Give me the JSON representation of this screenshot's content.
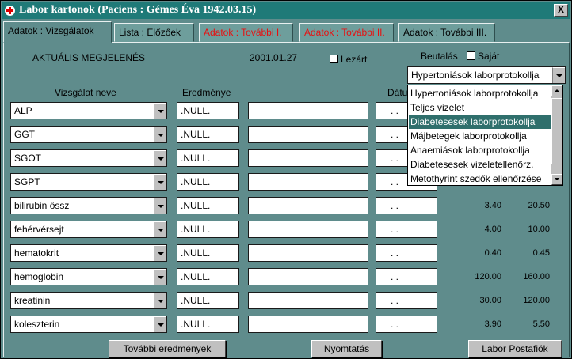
{
  "window": {
    "title": "Labor kartonok (Paciens : Gémes Éva 1942.03.15)",
    "close_label": "X"
  },
  "tabs": [
    {
      "label": "Adatok : Vizsgálatok",
      "active": true
    },
    {
      "label": "Lista : Előzőek"
    },
    {
      "label": "Adatok : További I."
    },
    {
      "label": "Adatok : További II."
    },
    {
      "label": "Adatok : További III."
    }
  ],
  "header": {
    "view_label": "AKTUÁLIS MEGJELENÉS",
    "date": "2001.01.27",
    "lezart_label": "Lezárt",
    "beutalas_label": "Beutalás",
    "sajat_label": "Saját",
    "protocol_selected": "Hypertoniások laborprotokollja"
  },
  "columns": {
    "name": "Vizsgálat neve",
    "result": "Eredménye",
    "date": "Dátum"
  },
  "rows": [
    {
      "name": "ALP",
      "result": ".NULL.",
      "note": "",
      "date": ". .",
      "min": "",
      "max": ""
    },
    {
      "name": "GGT",
      "result": ".NULL.",
      "note": "",
      "date": ". .",
      "min": "",
      "max": ""
    },
    {
      "name": "SGOT",
      "result": ".NULL.",
      "note": "",
      "date": ". .",
      "min": "",
      "max": ""
    },
    {
      "name": "SGPT",
      "result": ".NULL.",
      "note": "",
      "date": ". .",
      "min": "",
      "max": ""
    },
    {
      "name": "bilirubin össz",
      "result": ".NULL.",
      "note": "",
      "date": ". .",
      "min": "3.40",
      "max": "20.50"
    },
    {
      "name": "fehérvérsejt",
      "result": ".NULL.",
      "note": "",
      "date": ". .",
      "min": "4.00",
      "max": "10.00"
    },
    {
      "name": "hematokrit",
      "result": ".NULL.",
      "note": "",
      "date": ". .",
      "min": "0.40",
      "max": "0.45"
    },
    {
      "name": "hemoglobin",
      "result": ".NULL.",
      "note": "",
      "date": ". .",
      "min": "120.00",
      "max": "160.00"
    },
    {
      "name": "kreatinin",
      "result": ".NULL.",
      "note": "",
      "date": ". .",
      "min": "30.00",
      "max": "120.00"
    },
    {
      "name": "koleszterin",
      "result": ".NULL.",
      "note": "",
      "date": ". .",
      "min": "3.90",
      "max": "5.50"
    }
  ],
  "dropdown_options": [
    "Hypertoniások laborprotokollja",
    "Teljes vizelet",
    "Diabetesesek laborprotokollja",
    "Májbetegek laborprotokollja",
    "Anaemiások laborprotokollja",
    "Diabetesesek vizeletellenőrz.",
    "Metothyrint szedők ellenőrzése"
  ],
  "dropdown_selected_index": 2,
  "buttons": {
    "more_results": "További eredmények",
    "print": "Nyomtatás",
    "mailbox": "Labor Postafiók"
  },
  "colors": {
    "titlebar": "#1f7a78",
    "background": "#5f8c8c",
    "red_tab_text": "#e81010",
    "selection": "#2f6f6c"
  }
}
